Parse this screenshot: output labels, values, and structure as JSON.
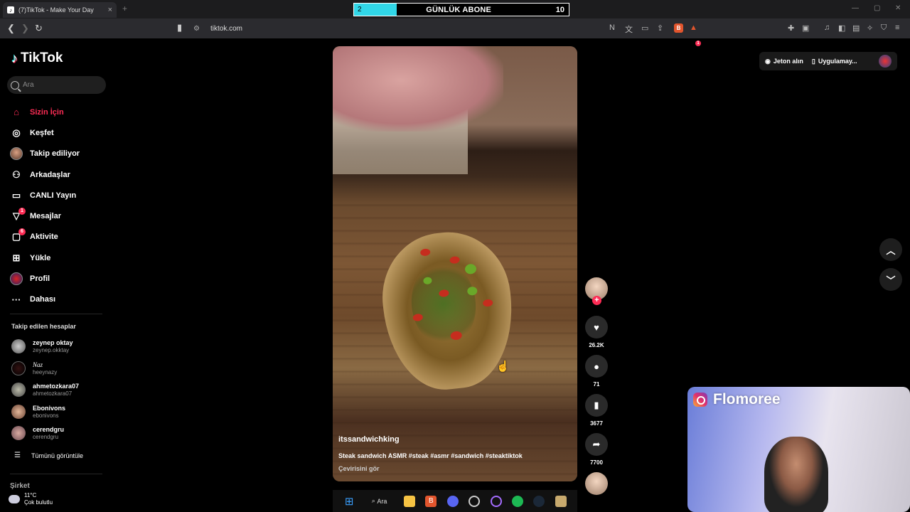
{
  "browser": {
    "tab_title": "(7)TikTok - Make Your Day",
    "tab_close": "×",
    "new_tab": "+",
    "url": "tiktok.com",
    "extension_badge": "1"
  },
  "overlay": {
    "bar_label": "GÜNLÜK ABONE",
    "current": "2",
    "goal": "10",
    "progress": 0.2,
    "accent": "#31d7e8"
  },
  "tiktok": {
    "brand": "TikTok",
    "search_placeholder": "Ara",
    "menu": [
      {
        "label": "Sizin İçin",
        "icon": "home-icon",
        "badge": ""
      },
      {
        "label": "Keşfet",
        "icon": "compass-icon",
        "badge": ""
      },
      {
        "label": "Takip ediliyor",
        "icon": "following-avatar-icon",
        "badge": ""
      },
      {
        "label": "Arkadaşlar",
        "icon": "friends-icon",
        "badge": ""
      },
      {
        "label": "CANLI Yayın",
        "icon": "live-icon",
        "badge": ""
      },
      {
        "label": "Mesajlar",
        "icon": "messages-icon",
        "badge": "1"
      },
      {
        "label": "Aktivite",
        "icon": "activity-icon",
        "badge": "6"
      },
      {
        "label": "Yükle",
        "icon": "upload-icon",
        "badge": ""
      },
      {
        "label": "Profil",
        "icon": "profile-icon",
        "badge": ""
      },
      {
        "label": "Dahası",
        "icon": "more-icon",
        "badge": ""
      }
    ],
    "following_header": "Takip edilen hesaplar",
    "accounts": [
      {
        "name": "zeynep oktay",
        "user": "zeynep.okktay"
      },
      {
        "name": "Naz",
        "user": "heeynazy"
      },
      {
        "name": "ahmetozkara07",
        "user": "ahmetozkara07"
      },
      {
        "name": "Ebonivons",
        "user": "ebonivons"
      },
      {
        "name": "cerendgru",
        "user": "cerendgru"
      }
    ],
    "see_all": "Tümünü görüntüle",
    "company": "Şirket",
    "top_right": {
      "coins": "Jeton alın",
      "app": "Uygulamay..."
    },
    "video": {
      "username": "itssandwichking",
      "description": "Steak sandwich ASMR #steak #asmr #sandwich #steaktiktok",
      "translate": "Çevirisini gör",
      "likes": "26.2K",
      "comments": "71",
      "saves": "3677",
      "shares": "7700"
    }
  },
  "webcam": {
    "name": "Flomoree"
  },
  "taskbar": {
    "search": "Ara",
    "temp": "11°C",
    "weather": "Çok bulutlu"
  },
  "colors": {
    "accent": "#fe2c55",
    "background": "#000000"
  }
}
